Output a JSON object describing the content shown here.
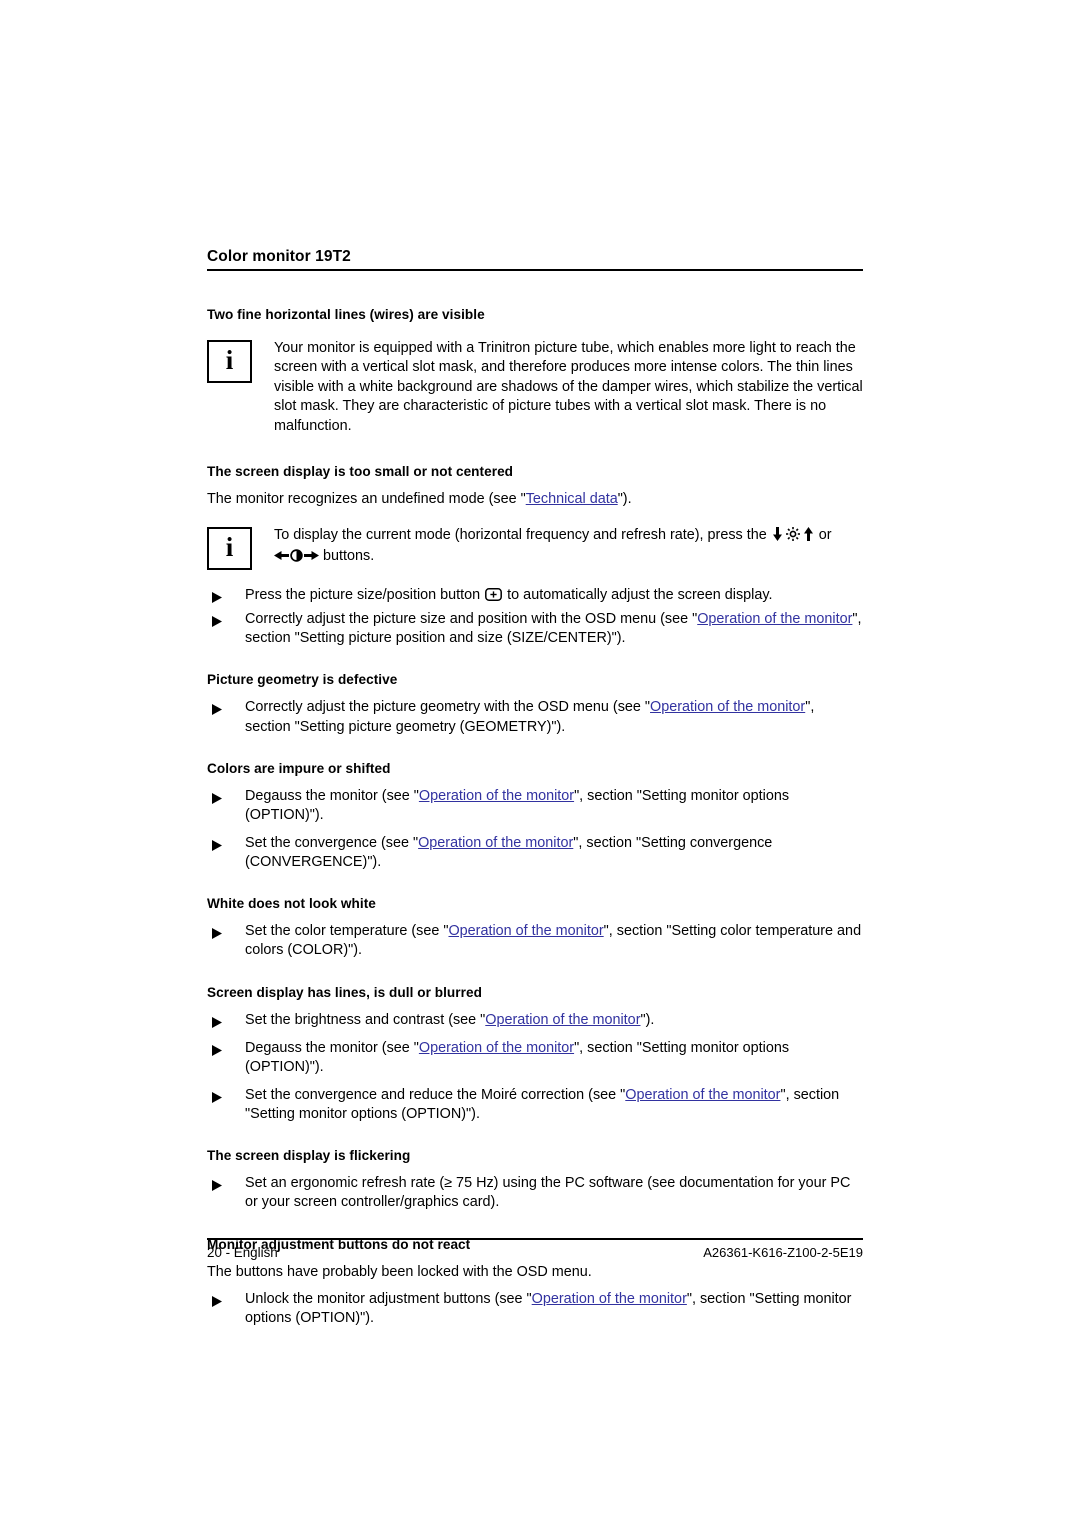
{
  "running_header": {
    "title": "Color monitor 19T2"
  },
  "link_color": "#3232a0",
  "sections": [
    {
      "heading": "Two fine horizontal lines (wires) are visible",
      "note": {
        "icon": "info-icon",
        "icon_glyph": "i",
        "text": "Your monitor is equipped with a Trinitron picture tube, which enables more light to reach the screen with a vertical slot mask, and therefore produces more intense colors. The thin lines visible with a white background are shadows of the damper wires, which stabilize the vertical slot mask. They are characteristic of picture tubes with a vertical slot mask. There is no malfunction."
      }
    },
    {
      "heading": "The screen display is too small or not centered",
      "paragraph_pre": "The monitor recognizes an undefined mode (see \"",
      "paragraph_link": "Technical data",
      "paragraph_post": "\").",
      "note2": {
        "icon": "info-icon",
        "icon_glyph": "i",
        "part1": "To display the current mode (horizontal frequency and refresh rate), press the ",
        "part2": " or ",
        "part3": " buttons.",
        "icons_row1": [
          "arrow-down-icon",
          "brightness-sun-icon",
          "arrow-up-icon"
        ],
        "icons_row2": [
          "arrow-left-icon",
          "contrast-icon",
          "arrow-right-icon"
        ]
      },
      "bullets": [
        {
          "pre": "Press the picture size/position button ",
          "icon": "picture-size-position-button-icon",
          "post": " to automatically adjust the screen display."
        },
        {
          "pre": "Correctly adjust the picture size and position with the OSD menu (see \"",
          "link": "Operation of the monitor",
          "post": "\", section \"Setting picture position and size (SIZE/CENTER)\")."
        }
      ]
    },
    {
      "heading": "Picture geometry is defective",
      "bullets": [
        {
          "pre": "Correctly adjust the picture geometry with the OSD menu (see \"",
          "link": "Operation of the monitor",
          "post": "\", section \"Setting picture geometry (GEOMETRY)\")."
        }
      ]
    },
    {
      "heading": "Colors are impure or shifted",
      "bullets": [
        {
          "pre": "Degauss the monitor (see \"",
          "link": "Operation of the monitor",
          "post": "\", section \"Setting monitor options (OPTION)\")."
        },
        {
          "pre": "Set the convergence (see \"",
          "link": "Operation of the monitor",
          "post": "\", section \"Setting convergence (CONVERGENCE)\")."
        }
      ]
    },
    {
      "heading": "White does not look white",
      "bullets": [
        {
          "pre": "Set the color temperature (see \"",
          "link": "Operation of the monitor",
          "post": "\", section \"Setting color temperature and colors (COLOR)\")."
        }
      ]
    },
    {
      "heading": "Screen display has lines, is dull or blurred",
      "bullets": [
        {
          "pre": "Set the brightness and contrast (see \"",
          "link": "Operation of the monitor",
          "post": "\")."
        },
        {
          "pre": "Degauss the monitor (see \"",
          "link": "Operation of the monitor",
          "post": "\", section \"Setting monitor options (OPTION)\")."
        },
        {
          "pre": "Set the convergence and reduce the Moiré correction (see \"",
          "link": "Operation of the monitor",
          "post": "\", section \"Setting monitor options (OPTION)\")."
        }
      ]
    },
    {
      "heading": "The screen display is flickering",
      "bullets": [
        {
          "pre": "Set an ergonomic refresh rate (≥ 75 Hz) using the PC software (see documentation for your PC or your screen controller/graphics card).",
          "link": "",
          "post": ""
        }
      ]
    },
    {
      "heading": "Monitor adjustment buttons do not react",
      "paragraph": "The buttons have probably been locked with the OSD menu.",
      "bullets": [
        {
          "pre": "Unlock the monitor adjustment buttons (see \"",
          "link": "Operation of the monitor",
          "post": "\", section \"Setting monitor options (OPTION)\")."
        }
      ]
    }
  ],
  "footer": {
    "left": "20 - English",
    "right": "A26361-K616-Z100-2-5E19"
  }
}
